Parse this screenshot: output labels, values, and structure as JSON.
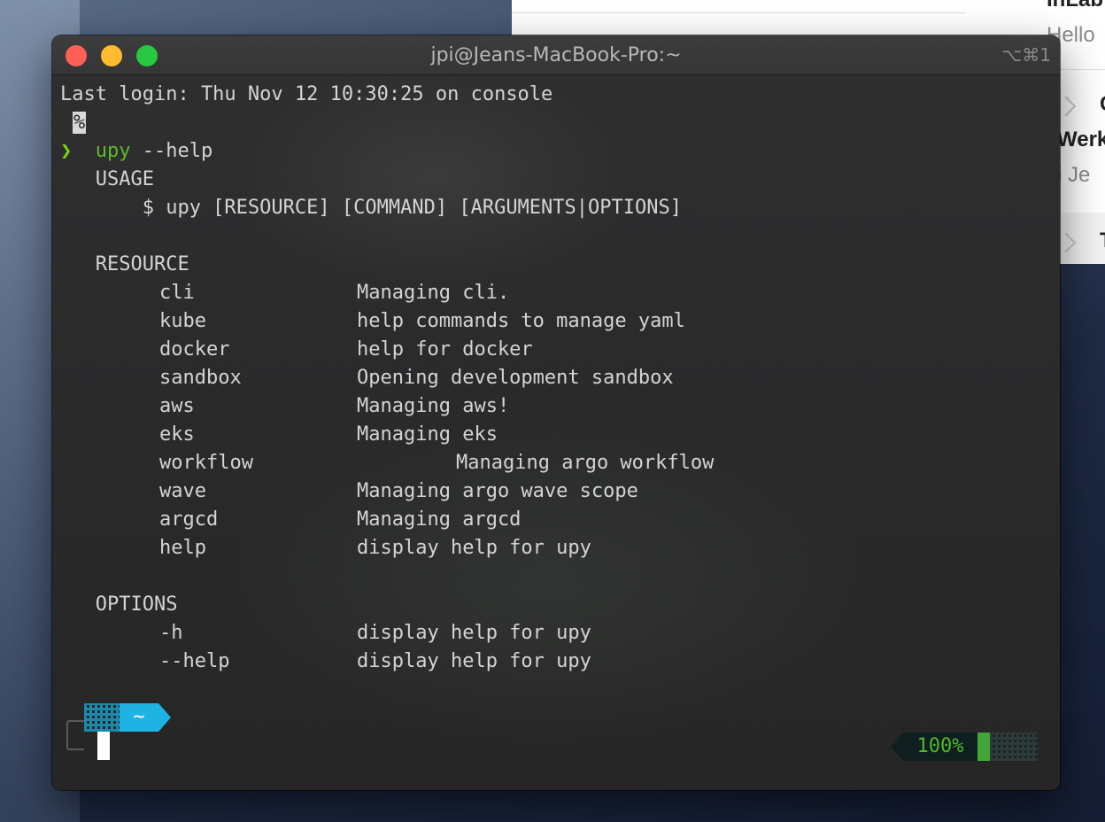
{
  "background_window": {
    "title_fragment": "InLab",
    "preview_fragment": "Hello",
    "item2_initial": "C",
    "item2_subject_fragment": "Werk",
    "item2_preview_fragment": "i Je",
    "item3_initial": "T"
  },
  "terminal": {
    "title": "jpi@Jeans-MacBook-Pro:~",
    "shortcut": "⌥⌘1",
    "lines": {
      "last_login": "Last login: Thu Nov 12 10:30:25 on console",
      "percent": "%",
      "prompt_arrow": "❯",
      "command_name": "upy",
      "command_args": " --help",
      "usage_header": "   USAGE",
      "usage_line": "       $ upy [RESOURCE] [COMMAND] [ARGUMENTS|OPTIONS]",
      "resource_header": "   RESOURCE",
      "options_header": "   OPTIONS"
    },
    "resources": [
      {
        "name": "cli",
        "desc": "Managing cli."
      },
      {
        "name": "kube",
        "desc": "help commands to manage yaml"
      },
      {
        "name": "docker",
        "desc": "help for docker"
      },
      {
        "name": "sandbox",
        "desc": "Opening development sandbox"
      },
      {
        "name": "aws",
        "desc": "Managing aws!"
      },
      {
        "name": "eks",
        "desc": "Managing eks"
      },
      {
        "name": "workflow",
        "desc": "Managing argo workflow"
      },
      {
        "name": "wave",
        "desc": "Managing argo wave scope"
      },
      {
        "name": "argcd",
        "desc": "Managing argcd"
      },
      {
        "name": "help",
        "desc": "display help for upy"
      }
    ],
    "options": [
      {
        "name": "-h",
        "desc": "display help for upy"
      },
      {
        "name": "--help",
        "desc": "display help for upy"
      }
    ],
    "prompt": {
      "dir": "~",
      "battery": "100%"
    },
    "colors": {
      "prompt_accent": "#1fb3e4",
      "battery_text": "#4fb82d",
      "arrow": "#7bd11b"
    }
  }
}
